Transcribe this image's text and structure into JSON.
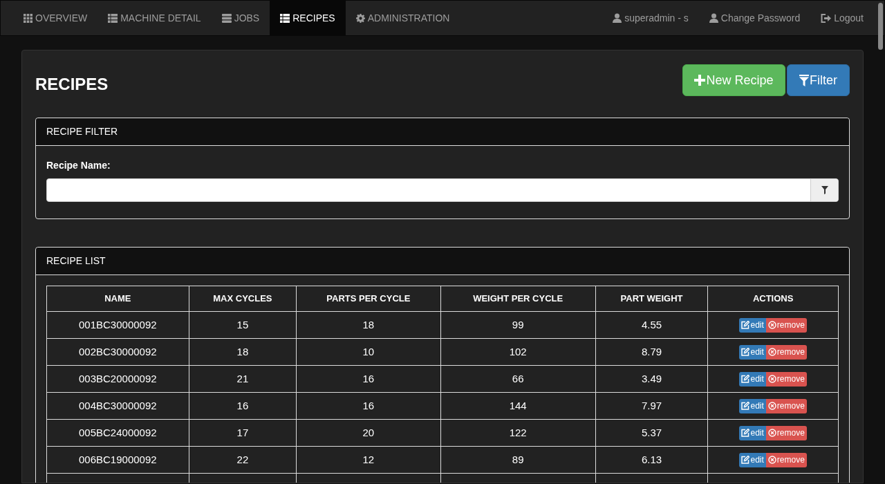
{
  "nav": {
    "tabs": [
      {
        "label": "OVERVIEW",
        "kind": "grid",
        "selected": false
      },
      {
        "label": "MACHINE DETAIL",
        "kind": "list",
        "selected": false
      },
      {
        "label": "JOBS",
        "kind": "stack",
        "selected": false
      },
      {
        "label": "RECIPES",
        "kind": "list",
        "selected": true
      },
      {
        "label": "ADMINISTRATION",
        "kind": "gear",
        "selected": false
      }
    ],
    "right": [
      {
        "label": "superadmin - s",
        "kind": "user"
      },
      {
        "label": "Change Password",
        "kind": "user"
      },
      {
        "label": "Logout",
        "kind": "logout"
      }
    ]
  },
  "page": {
    "title": "RECIPES",
    "buttons": [
      {
        "label": "New Recipe",
        "kind": "new"
      },
      {
        "label": "Filter",
        "kind": "filter"
      }
    ]
  },
  "filter_panel": {
    "title": "RECIPE FILTER",
    "field_label": "Recipe Name:"
  },
  "list_panel": {
    "title": "RECIPE LIST",
    "table": {
      "columns": [
        "NAME",
        "MAX CYCLES",
        "PARTS PER CYCLE",
        "WEIGHT PER CYCLE",
        "PART WEIGHT",
        "ACTIONS"
      ],
      "rows": [
        {
          "cells": [
            "001BC30000092",
            "15",
            "18",
            "99",
            "4.55"
          ],
          "actions": [
            "edit",
            "remove"
          ]
        },
        {
          "cells": [
            "002BC30000092",
            "18",
            "10",
            "102",
            "8.79"
          ],
          "actions": [
            "edit",
            "remove"
          ]
        },
        {
          "cells": [
            "003BC20000092",
            "21",
            "16",
            "66",
            "3.49"
          ],
          "actions": [
            "edit",
            "remove"
          ]
        },
        {
          "cells": [
            "004BC30000092",
            "16",
            "16",
            "144",
            "7.97"
          ],
          "actions": [
            "edit",
            "remove"
          ]
        },
        {
          "cells": [
            "005BC24000092",
            "17",
            "20",
            "122",
            "5.37"
          ],
          "actions": [
            "edit",
            "remove"
          ]
        },
        {
          "cells": [
            "006BC19000092",
            "22",
            "12",
            "89",
            "6.13"
          ],
          "actions": [
            "edit",
            "remove"
          ]
        }
      ]
    }
  }
}
